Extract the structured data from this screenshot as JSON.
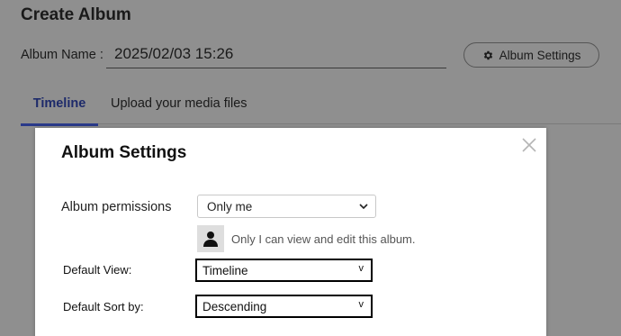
{
  "page": {
    "title": "Create Album",
    "album_name_label": "Album Name :",
    "album_name_value": "2025/02/03 15:26",
    "settings_button_label": "Album Settings",
    "tabs": [
      {
        "label": "Timeline",
        "active": true
      },
      {
        "label": "Upload your media files",
        "active": false
      }
    ]
  },
  "modal": {
    "title": "Album Settings",
    "permissions_label": "Album permissions",
    "permissions_value": "Only me",
    "permissions_description": "Only I can view and edit this album.",
    "default_view_label": "Default View:",
    "default_view_value": "Timeline",
    "default_sort_label": "Default Sort by:",
    "default_sort_value": "Descending",
    "dropdown_glyph": "v"
  },
  "icons": {
    "settings": "gear-icon",
    "close": "close-icon",
    "dropdown": "chevron-down-icon",
    "user": "user-icon"
  },
  "colors": {
    "overlay_background": "#8f8f8f",
    "active_tab": "#2a3a8a",
    "modal_background": "#ffffff"
  }
}
